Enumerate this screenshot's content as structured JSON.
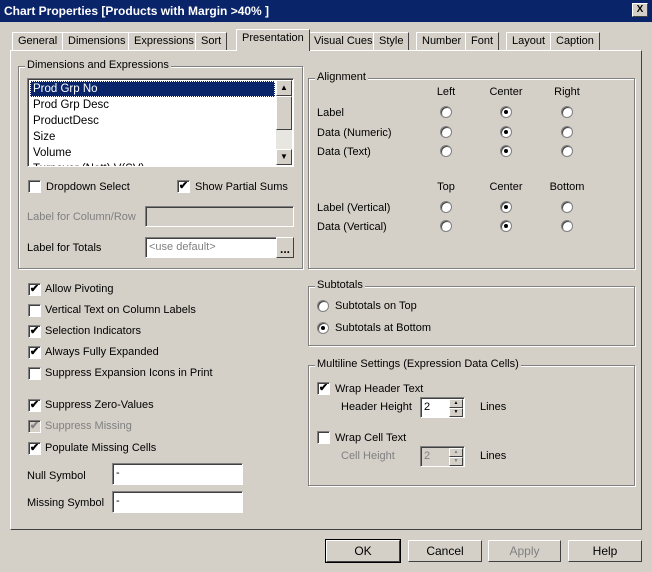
{
  "window": {
    "title": "Chart Properties [Products with Margin >40% ]",
    "close": "X"
  },
  "tabs": [
    "General",
    "Dimensions",
    "Expressions",
    "Sort",
    "Presentation",
    "Visual Cues",
    "Style",
    "Number",
    "Font",
    "Layout",
    "Caption"
  ],
  "active_tab": "Presentation",
  "dims": {
    "legend": "Dimensions and Expressions",
    "items": [
      "Prod Grp No",
      "Prod Grp Desc",
      "ProductDesc",
      "Size",
      "Volume",
      "Turnover (Nett) V(SV)"
    ],
    "selected": "Prod Grp No",
    "dropdown_select": {
      "label": "Dropdown Select",
      "checked": false
    },
    "show_partial_sums": {
      "label": "Show Partial Sums",
      "checked": true
    },
    "label_col_row": {
      "label": "Label for Column/Row",
      "value": ""
    },
    "label_totals": {
      "label": "Label for Totals",
      "placeholder": "<use default>",
      "browse": "..."
    }
  },
  "alignment": {
    "legend": "Alignment",
    "h_cols": [
      "Left",
      "Center",
      "Right"
    ],
    "v_cols": [
      "Top",
      "Center",
      "Bottom"
    ],
    "h_rows": [
      {
        "label": "Label",
        "selected": "Center"
      },
      {
        "label": "Data (Numeric)",
        "selected": "Center"
      },
      {
        "label": "Data (Text)",
        "selected": "Center"
      }
    ],
    "v_rows": [
      {
        "label": "Label (Vertical)",
        "selected": "Center"
      },
      {
        "label": "Data (Vertical)",
        "selected": "Center"
      }
    ]
  },
  "options": [
    {
      "label": "Allow Pivoting",
      "checked": true,
      "disabled": false
    },
    {
      "label": "Vertical Text on Column Labels",
      "checked": false,
      "disabled": false
    },
    {
      "label": "Selection Indicators",
      "checked": true,
      "disabled": false
    },
    {
      "label": "Always Fully Expanded",
      "checked": true,
      "disabled": false
    },
    {
      "label": "Suppress Expansion Icons in Print",
      "checked": false,
      "disabled": false
    },
    {
      "label": "Suppress Zero-Values",
      "checked": true,
      "disabled": false
    },
    {
      "label": "Suppress Missing",
      "checked": true,
      "disabled": true
    },
    {
      "label": "Populate Missing Cells",
      "checked": true,
      "disabled": false
    }
  ],
  "null_symbol": {
    "label": "Null Symbol",
    "value": "-"
  },
  "missing_symbol": {
    "label": "Missing Symbol",
    "value": "-"
  },
  "subtotals": {
    "legend": "Subtotals",
    "options": [
      "Subtotals on Top",
      "Subtotals at Bottom"
    ],
    "selected": "Subtotals at Bottom"
  },
  "multiline": {
    "legend": "Multiline Settings (Expression Data Cells)",
    "wrap_header": {
      "label": "Wrap Header Text",
      "checked": true
    },
    "header_height": {
      "label": "Header Height",
      "value": "2",
      "unit": "Lines"
    },
    "wrap_cell": {
      "label": "Wrap Cell Text",
      "checked": false
    },
    "cell_height": {
      "label": "Cell Height",
      "value": "2",
      "unit": "Lines"
    }
  },
  "buttons": {
    "ok": "OK",
    "cancel": "Cancel",
    "apply": "Apply",
    "help": "Help"
  }
}
